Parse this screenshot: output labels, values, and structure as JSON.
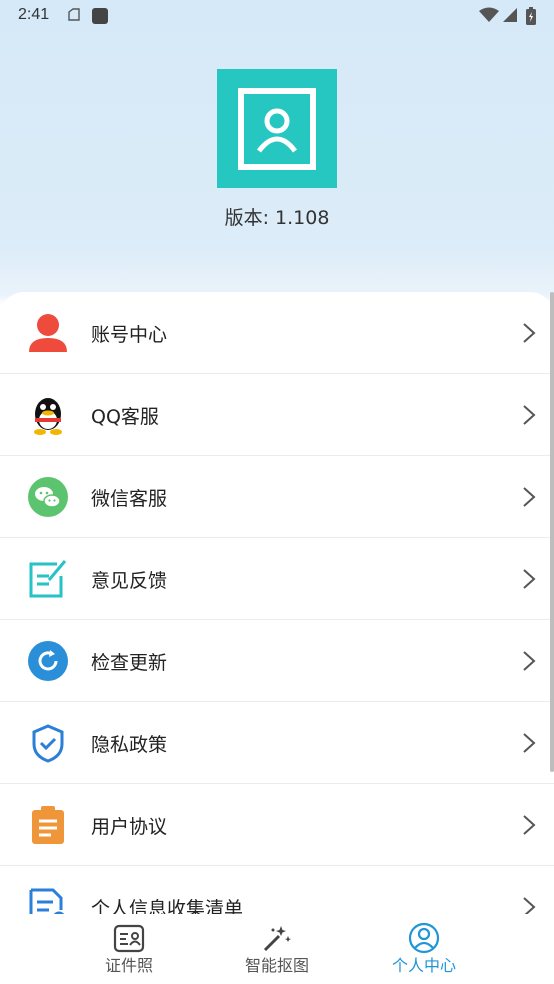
{
  "status_bar": {
    "time": "2:41"
  },
  "header": {
    "version": "版本: 1.108"
  },
  "menu": [
    {
      "label": "账号中心",
      "icon": "person-icon",
      "color": "#ef4b3c"
    },
    {
      "label": "QQ客服",
      "icon": "qq-icon",
      "color": "#111111"
    },
    {
      "label": "微信客服",
      "icon": "wechat-icon",
      "color": "#5cc46e"
    },
    {
      "label": "意见反馈",
      "icon": "feedback-icon",
      "color": "#27c2c6"
    },
    {
      "label": "检查更新",
      "icon": "refresh-icon",
      "color": "#2a8fd8"
    },
    {
      "label": "隐私政策",
      "icon": "shield-icon",
      "color": "#2a7fd8"
    },
    {
      "label": "用户协议",
      "icon": "clipboard-icon",
      "color": "#f0963a"
    },
    {
      "label": "个人信息收集清单",
      "icon": "document-search-icon",
      "color": "#2a7fd8"
    }
  ],
  "bottom_nav": [
    {
      "label": "证件照",
      "icon": "id-card-icon",
      "active": false
    },
    {
      "label": "智能抠图",
      "icon": "magic-wand-icon",
      "active": false
    },
    {
      "label": "个人中心",
      "icon": "user-circle-icon",
      "active": true
    }
  ],
  "colors": {
    "accent": "#2196d6",
    "logo_bg": "#27c7c1"
  }
}
